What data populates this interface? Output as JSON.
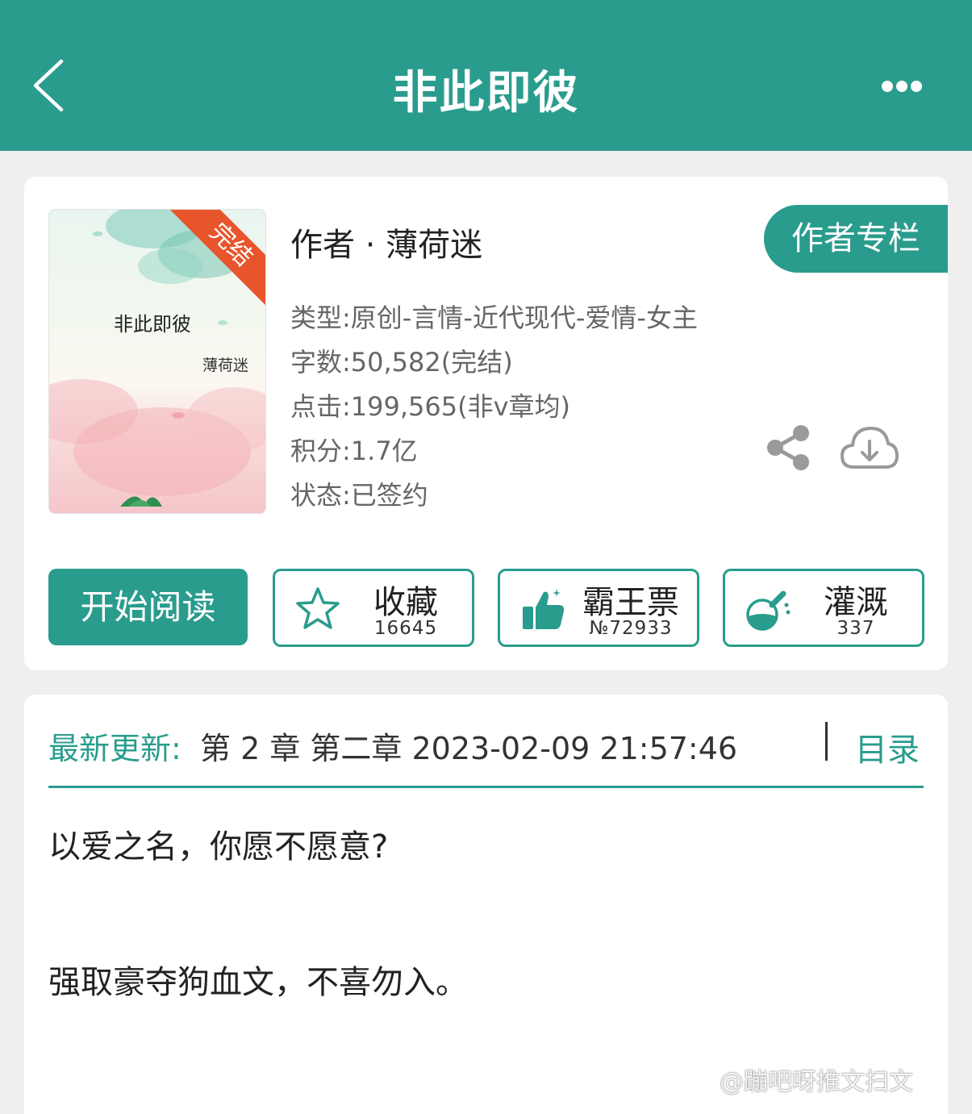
{
  "header": {
    "title": "非此即彼",
    "back_icon": "chevron-left-icon",
    "more_icon": "more-horizontal-icon"
  },
  "book": {
    "cover": {
      "title": "非此即彼",
      "author": "薄荷迷",
      "ribbon": "完结"
    },
    "author_line": "作者 · 薄荷迷",
    "author_column_label": "作者专栏",
    "info": {
      "type": "类型:原创-言情-近代现代-爱情-女主",
      "words": "字数:50,582(完结)",
      "clicks": "点击:199,565(非v章均)",
      "score": "积分:1.7亿",
      "status": "状态:已签约"
    }
  },
  "actions": {
    "start_reading": "开始阅读",
    "favorite": {
      "label": "收藏",
      "count": "16645",
      "icon": "star-icon"
    },
    "ticket": {
      "label": "霸王票",
      "count": "№72933",
      "icon": "thumbs-up-icon"
    },
    "water": {
      "label": "灌溉",
      "count": "337",
      "icon": "flask-icon"
    }
  },
  "update": {
    "label": "最新更新:",
    "text": "第 2 章 第二章 2023-02-09 21:57:46",
    "toc_label": "目录"
  },
  "description": {
    "line1": "以爱之名，你愿不愿意?",
    "line2": "强取豪夺狗血文，不喜勿入。"
  },
  "watermark": "@蹦吧呀推文扫文",
  "colors": {
    "primary": "#2a9c8d",
    "ribbon": "#e8552c"
  }
}
